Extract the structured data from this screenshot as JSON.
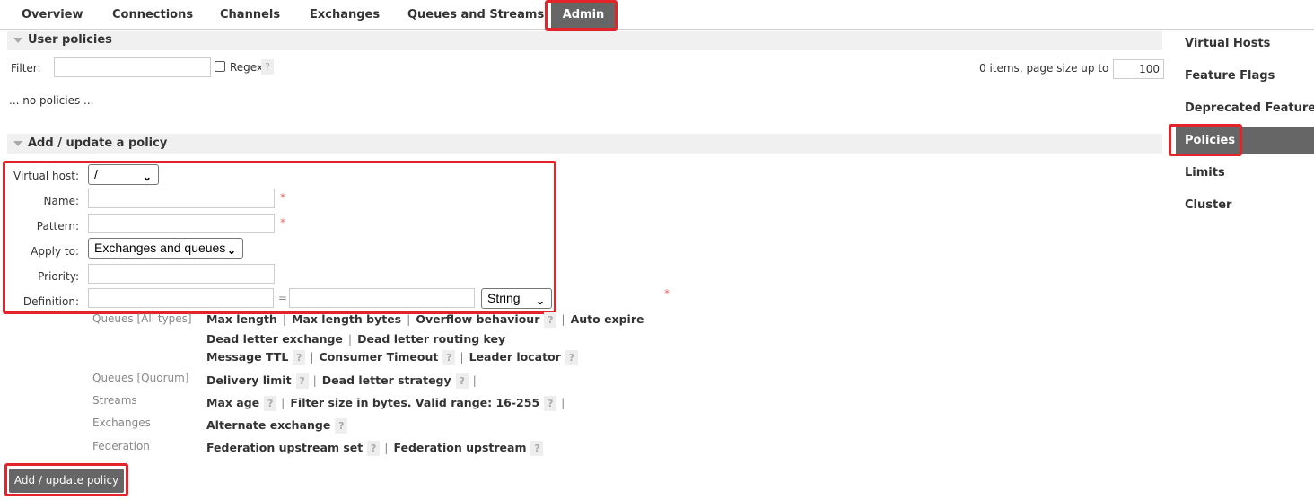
{
  "tabs": [
    "Overview",
    "Connections",
    "Channels",
    "Exchanges",
    "Queues and Streams",
    "Admin"
  ],
  "user_policies": {
    "title": "User policies",
    "filter_label": "Filter:",
    "filter_value": "",
    "regex_label": "Regex",
    "help": "?",
    "items_text": "0 items, page size up to",
    "page_size": "100",
    "empty_text": "... no policies ..."
  },
  "add_policy": {
    "title": "Add / update a policy",
    "vhost_label": "Virtual host:",
    "vhost_value": "/",
    "name_label": "Name:",
    "pattern_label": "Pattern:",
    "apply_label": "Apply to:",
    "apply_value": "Exchanges and queues",
    "priority_label": "Priority:",
    "definition_label": "Definition:",
    "equals": "=",
    "type_value": "String",
    "required": "*"
  },
  "quick_links": {
    "queues_all": {
      "label": "Queues [All types]",
      "line1": [
        "Max length",
        "Max length bytes",
        "Overflow behaviour",
        "Auto expire"
      ],
      "line2": [
        "Dead letter exchange",
        "Dead letter routing key"
      ],
      "line3": [
        "Message TTL",
        "Consumer Timeout",
        "Leader locator"
      ]
    },
    "queues_quorum": {
      "label": "Queues [Quorum]",
      "items": [
        "Delivery limit",
        "Dead letter strategy"
      ]
    },
    "streams": {
      "label": "Streams",
      "items": [
        "Max age",
        "Filter size in bytes. Valid range: 16-255"
      ]
    },
    "exchanges": {
      "label": "Exchanges",
      "items": [
        "Alternate exchange"
      ]
    },
    "federation": {
      "label": "Federation",
      "items": [
        "Federation upstream set",
        "Federation upstream"
      ]
    }
  },
  "sidebar": [
    "Virtual Hosts",
    "Feature Flags",
    "Deprecated Features",
    "Policies",
    "Limits",
    "Cluster"
  ],
  "submit_label": "Add / update policy",
  "colors": {
    "active_bg": "#666666",
    "highlight": "#e3242b",
    "section_bg": "#f0f0f0"
  },
  "icons": [
    "chevron-down-icon",
    "collapse-triangle-icon",
    "help-icon",
    "checkbox-icon"
  ]
}
